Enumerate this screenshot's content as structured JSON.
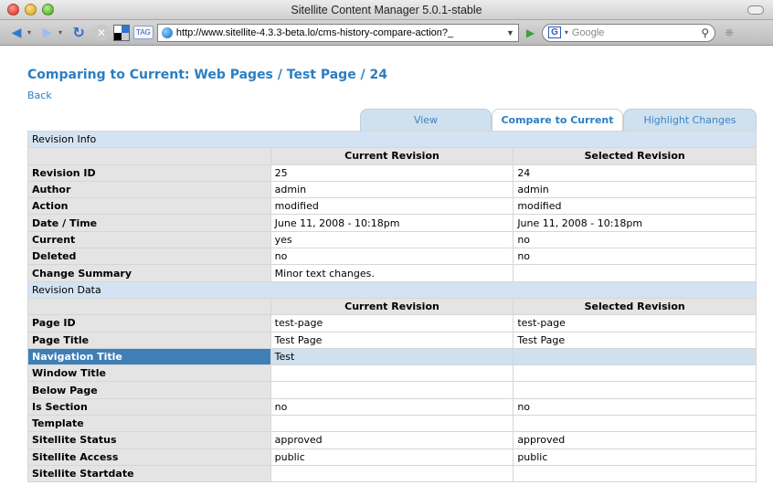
{
  "window": {
    "title": "Sitellite Content Manager 5.0.1-stable"
  },
  "toolbar": {
    "url": "http://www.sitellite-4.3.3-beta.lo/cms-history-compare-action?_",
    "search_placeholder": "Google",
    "tag_label": "TAG"
  },
  "page": {
    "title": "Comparing to Current: Web Pages / Test Page / 24",
    "back_label": "Back"
  },
  "tabs": [
    {
      "label": "View",
      "active": false
    },
    {
      "label": "Compare to Current",
      "active": true
    },
    {
      "label": "Highlight Changes",
      "active": false
    }
  ],
  "sections": {
    "info_title": "Revision Info",
    "data_title": "Revision Data",
    "col_current": "Current Revision",
    "col_selected": "Selected Revision"
  },
  "info_rows": [
    {
      "label": "Revision ID",
      "current": "25",
      "selected": "24"
    },
    {
      "label": "Author",
      "current": "admin",
      "selected": "admin"
    },
    {
      "label": "Action",
      "current": "modified",
      "selected": "modified"
    },
    {
      "label": "Date / Time",
      "current": "June 11, 2008 - 10:18pm",
      "selected": "June 11, 2008 - 10:18pm"
    },
    {
      "label": "Current",
      "current": "yes",
      "selected": "no"
    },
    {
      "label": "Deleted",
      "current": "no",
      "selected": "no"
    },
    {
      "label": "Change Summary",
      "current": "Minor text changes.",
      "selected": ""
    }
  ],
  "data_rows": [
    {
      "label": "Page ID",
      "current": "test-page",
      "selected": "test-page",
      "changed": false
    },
    {
      "label": "Page Title",
      "current": "Test Page",
      "selected": "Test Page",
      "changed": false
    },
    {
      "label": "Navigation Title",
      "current": "Test",
      "selected": "",
      "changed": true
    },
    {
      "label": "Window Title",
      "current": "",
      "selected": "",
      "changed": false
    },
    {
      "label": "Below Page",
      "current": "",
      "selected": "",
      "changed": false
    },
    {
      "label": "Is Section",
      "current": "no",
      "selected": "no",
      "changed": false
    },
    {
      "label": "Template",
      "current": "",
      "selected": "",
      "changed": false
    },
    {
      "label": "Sitellite Status",
      "current": "approved",
      "selected": "approved",
      "changed": false
    },
    {
      "label": "Sitellite Access",
      "current": "public",
      "selected": "public",
      "changed": false
    },
    {
      "label": "Sitellite Startdate",
      "current": "",
      "selected": "",
      "changed": false
    }
  ]
}
